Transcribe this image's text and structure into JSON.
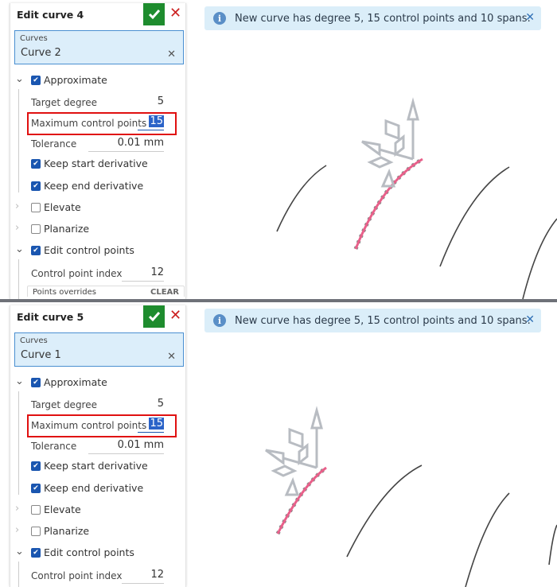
{
  "panels": [
    {
      "title": "Edit curve 4",
      "curves_label": "Curves",
      "curves_value": "Curve 2",
      "approximate": "Approximate",
      "target_degree_label": "Target degree",
      "target_degree": "5",
      "max_cp_label": "Maximum control points",
      "max_cp": "15",
      "tolerance_label": "Tolerance",
      "tolerance": "0.01 mm",
      "keep_start": "Keep start derivative",
      "keep_end": "Keep end derivative",
      "elevate": "Elevate",
      "planarize": "Planarize",
      "edit_cp": "Edit control points",
      "cp_index_label": "Control point index",
      "cp_index": "12",
      "points_overrides": "Points overrides",
      "clear": "CLEAR",
      "banner": "New curve has degree 5, 15 control points and 10 spans."
    },
    {
      "title": "Edit curve 5",
      "curves_label": "Curves",
      "curves_value": "Curve 1",
      "approximate": "Approximate",
      "target_degree_label": "Target degree",
      "target_degree": "5",
      "max_cp_label": "Maximum control points",
      "max_cp": "15",
      "tolerance_label": "Tolerance",
      "tolerance": "0.01 mm",
      "keep_start": "Keep start derivative",
      "keep_end": "Keep end derivative",
      "elevate": "Elevate",
      "planarize": "Planarize",
      "edit_cp": "Edit control points",
      "cp_index_label": "Control point index",
      "cp_index": "12",
      "banner": "New curve has degree 5, 15 control points and 10 spans."
    }
  ],
  "icons": {
    "check": "check-icon",
    "close": "close-icon",
    "info": "info-icon",
    "chevron": "chevron-icon"
  },
  "colors": {
    "accent": "#1a56b0",
    "confirm": "#1e8c2e",
    "cancel": "#cc2222",
    "highlight": "#e01010",
    "curve": "#e8608a",
    "banner": "#dbeef9"
  }
}
